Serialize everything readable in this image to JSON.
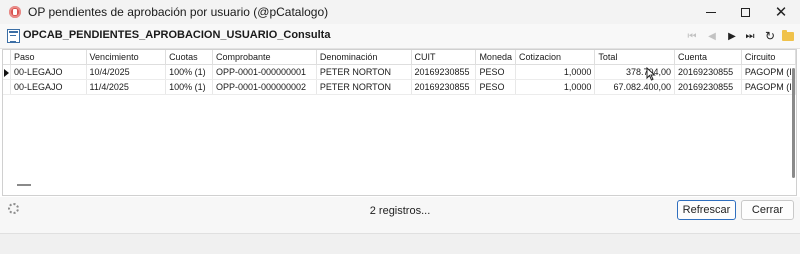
{
  "window": {
    "title": "OP pendientes de aprobación por usuario (@pCatalogo)",
    "minimize_glyph": "",
    "close_glyph": "✕"
  },
  "toolbar": {
    "form_title": "OPCAB_PENDIENTES_APROBACION_USUARIO_Consulta",
    "nav_icons": [
      "first-icon",
      "prev-icon",
      "next-icon",
      "last-icon",
      "refresh-icon",
      "folder-icon"
    ],
    "glyphs": {
      "first": "⏮",
      "prev": "◀",
      "next": "▶",
      "last": "⏭",
      "refresh": "↻"
    }
  },
  "table": {
    "columns": [
      "Paso",
      "Vencimiento",
      "Cuotas",
      "Comprobante",
      "Denominación",
      "CUIT",
      "Moneda",
      "Cotizacion",
      "Total",
      "Cuenta",
      "Circuito"
    ],
    "rows": [
      [
        "00-LEGAJO",
        "10/4/2025",
        "100% (1)",
        "OPP-0001-000000001",
        "PETER NORTON",
        "20169230855",
        "PESO",
        "1,0000",
        "378.704,00",
        "20169230855",
        "PAGOPM (I"
      ],
      [
        "00-LEGAJO",
        "11/4/2025",
        "100% (1)",
        "OPP-0001-000000002",
        "PETER NORTON",
        "20169230855",
        "PESO",
        "1,0000",
        "67.082.400,00",
        "20169230855",
        "PAGOPM (I"
      ]
    ]
  },
  "footer": {
    "record_count": "2 registros...",
    "refresh_label": "Refrescar",
    "close_label": "Cerrar"
  },
  "colors": {
    "accent": "#2f6fbf",
    "app_icon": "#d9534f",
    "folder": "#f0c24b"
  }
}
